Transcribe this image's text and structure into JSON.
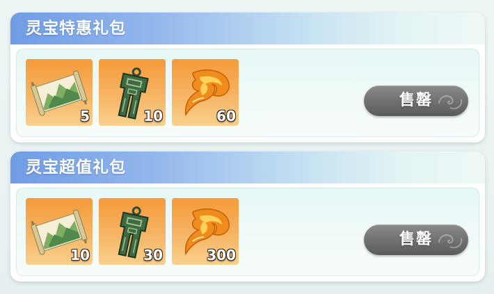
{
  "packs": [
    {
      "title": "灵宝特惠礼包",
      "items": [
        {
          "icon": "scroll-icon",
          "quantity": "5"
        },
        {
          "icon": "jade-token-icon",
          "quantity": "10"
        },
        {
          "icon": "flame-feather-icon",
          "quantity": "60"
        }
      ],
      "button_label": "售罄"
    },
    {
      "title": "灵宝超值礼包",
      "items": [
        {
          "icon": "scroll-icon",
          "quantity": "10"
        },
        {
          "icon": "jade-token-icon",
          "quantity": "30"
        },
        {
          "icon": "flame-feather-icon",
          "quantity": "300"
        }
      ],
      "button_label": "售罄"
    }
  ],
  "colors": {
    "header_blue": "#6f9ce6",
    "item_orange": "#f59a3a",
    "button_gray": "#6f6f6f"
  }
}
